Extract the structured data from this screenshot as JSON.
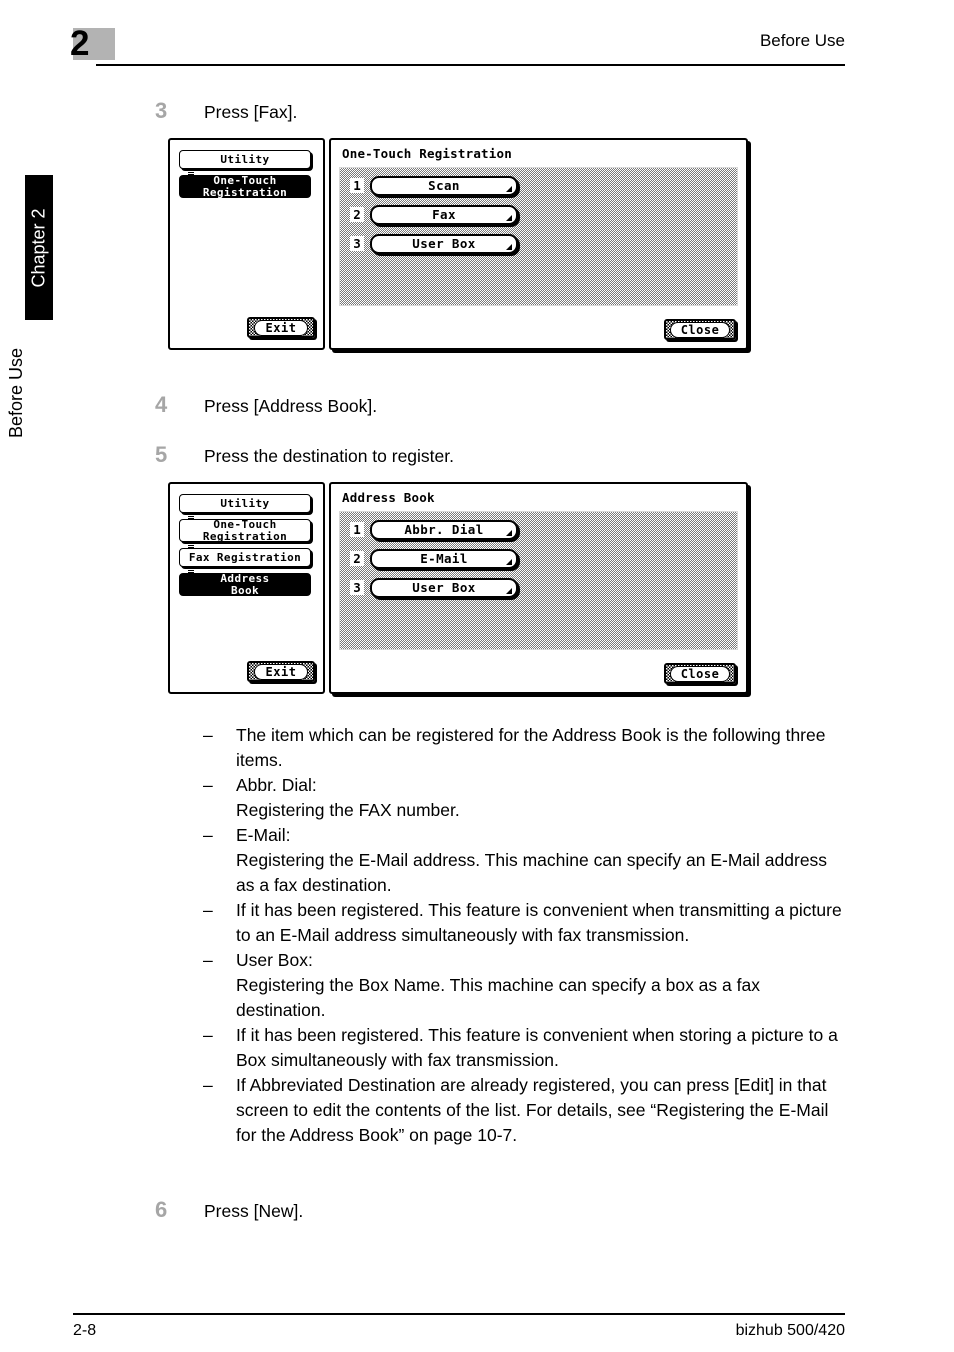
{
  "header": {
    "chapter_number": "2",
    "title": "Before Use"
  },
  "side_tabs": {
    "chapter_label": "Chapter 2",
    "section_label": "Before Use"
  },
  "steps": [
    {
      "number": "3",
      "text": "Press [Fax]."
    },
    {
      "number": "4",
      "text": "Press [Address Book]."
    },
    {
      "number": "5",
      "text": "Press the destination to register."
    },
    {
      "number": "6",
      "text": "Press [New]."
    }
  ],
  "screens": [
    {
      "menu_items": [
        {
          "label": "Utility",
          "selected": false
        },
        {
          "label": "One-Touch\nRegistration",
          "selected": true
        }
      ],
      "exit_label": "Exit",
      "pane_title": "One-Touch Registration",
      "destinations": [
        {
          "index": "1",
          "label": "Scan"
        },
        {
          "index": "2",
          "label": "Fax"
        },
        {
          "index": "3",
          "label": "User Box"
        }
      ],
      "close_label": "Close"
    },
    {
      "menu_items": [
        {
          "label": "Utility",
          "selected": false
        },
        {
          "label": "One-Touch\nRegistration",
          "selected": false
        },
        {
          "label": "Fax Registration",
          "selected": false
        },
        {
          "label": "Address\nBook",
          "selected": true
        }
      ],
      "exit_label": "Exit",
      "pane_title": "Address Book",
      "destinations": [
        {
          "index": "1",
          "label": "Abbr. Dial"
        },
        {
          "index": "2",
          "label": "E-Mail"
        },
        {
          "index": "3",
          "label": "User Box"
        }
      ],
      "close_label": "Close"
    }
  ],
  "notes": {
    "dash": "–",
    "items": [
      "The item which can be registered for the Address Book is the following three items.",
      "Abbr. Dial:\nRegistering the FAX number.",
      "E-Mail:\nRegistering the E-Mail address. This machine can specify an E-Mail address as a fax destination.",
      "If it has been registered. This feature is convenient when transmitting a picture to an E-Mail address simultaneously with fax transmission.",
      "User Box:\nRegistering the Box Name. This machine can specify a box as a fax destination.",
      "If it has been registered. This feature is convenient when storing a picture to a Box simultaneously with fax transmission.",
      "If Abbreviated Destination are already registered, you can press [Edit] in that screen to edit the contents of the list. For details, see “Registering the E-Mail for the Address Book” on page 10-7."
    ]
  },
  "footer": {
    "page_number": "2-8",
    "product": "bizhub 500/420"
  },
  "colors": {
    "chapter_box": "#b3b3b3",
    "step_number": "#a6a6a6",
    "tab_background": "#000000"
  }
}
